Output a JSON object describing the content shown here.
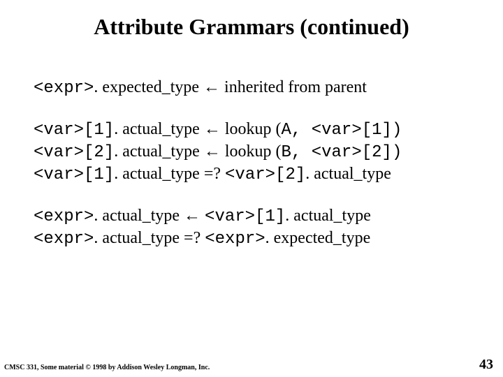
{
  "title": "Attribute Grammars (continued)",
  "arrow": "←",
  "block1": {
    "p1a": "<expr>",
    "p1b": ". expected_type ",
    "p1c": " inherited from parent"
  },
  "block2": {
    "l1a": "<var>[1]",
    "l1b": ". actual_type ",
    "l1c": " lookup (",
    "l1d": "A, <var>[1])",
    "l2a": "<var>[2]",
    "l2b": ". actual_type ",
    "l2c": " lookup (",
    "l2d": "B, <var>[2])",
    "l3a": "<var>[1]",
    "l3b": ". actual_type =? ",
    "l3c": "<var>[2]",
    "l3d": ". actual_type"
  },
  "block3": {
    "l1a": "<expr>",
    "l1b": ". actual_type ",
    "l1c": " ",
    "l1d": "<var>[1]",
    "l1e": ". actual_type",
    "l2a": "<expr>",
    "l2b": ". actual_type =? ",
    "l2c": "<expr>",
    "l2d": ". expected_type"
  },
  "footer": {
    "left": "CMSC 331, Some material © 1998 by Addison Wesley Longman, Inc.",
    "right": "43"
  }
}
